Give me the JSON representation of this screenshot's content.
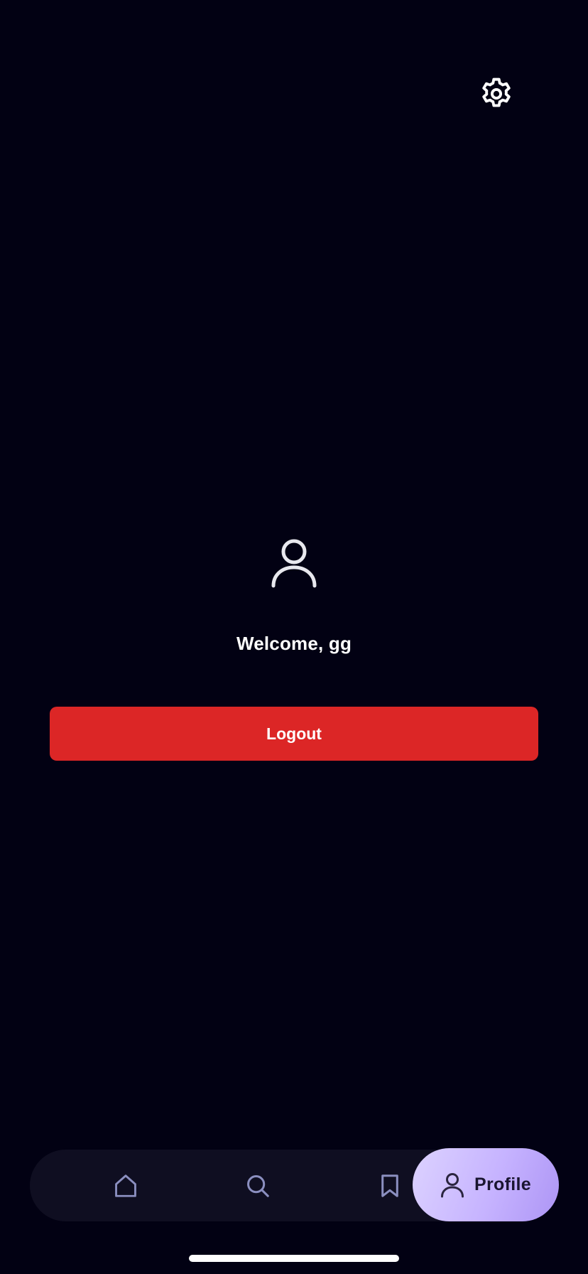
{
  "header": {
    "settings_icon": "gear-icon"
  },
  "profile": {
    "avatar_icon": "user-icon",
    "welcome_text": "Welcome, gg",
    "logout_label": "Logout"
  },
  "tabbar": {
    "items": [
      {
        "icon": "home-icon",
        "label": "",
        "active": false
      },
      {
        "icon": "search-icon",
        "label": "",
        "active": false
      },
      {
        "icon": "bookmark-icon",
        "label": "",
        "active": false
      },
      {
        "icon": "user-icon",
        "label": "Profile",
        "active": true
      }
    ]
  },
  "colors": {
    "background": "#020113",
    "logout_button": "#dc2626",
    "tabbar": "#0f0e21",
    "active_tab": "#c6b3ff",
    "inactive_icon": "#8b8fc0"
  }
}
